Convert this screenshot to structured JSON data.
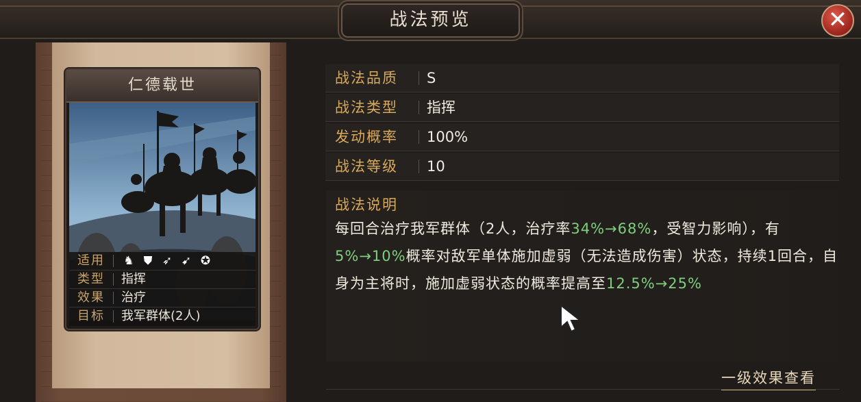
{
  "window": {
    "title": "战法预览",
    "close_label": "✕"
  },
  "card": {
    "name": "仁德载世",
    "rows": [
      {
        "label": "适用",
        "value": ""
      },
      {
        "label": "类型",
        "value": "指挥"
      },
      {
        "label": "效果",
        "value": "治疗"
      },
      {
        "label": "目标",
        "value": "我军群体(2人)"
      }
    ],
    "usage_icons": [
      "cavalry-icon",
      "shield-icon",
      "bow-icon",
      "spear-icon",
      "chariot-icon"
    ]
  },
  "details": [
    {
      "label": "战法品质",
      "value": "S"
    },
    {
      "label": "战法类型",
      "value": "指挥"
    },
    {
      "label": "发动概率",
      "value": "100%"
    },
    {
      "label": "战法等级",
      "value": "10"
    }
  ],
  "description": {
    "heading": "战法说明",
    "p1": "每回合治疗我军群体（2人，治疗率",
    "g1": "34%→68%",
    "p2": "，受智力影响），有",
    "g2": "5%→10%",
    "p3": "概率对敌军单体施加虚弱（无法造成伤害）状态，持续1回合，自身为主将时，施加虚弱状态的概率提高至",
    "g3": "12.5%→25%"
  },
  "links": {
    "level_one": "一级效果查看"
  },
  "colors": {
    "accent_gold": "#d9a95c",
    "highlight_green": "#7fcf7f",
    "close_red": "#a32a22"
  }
}
